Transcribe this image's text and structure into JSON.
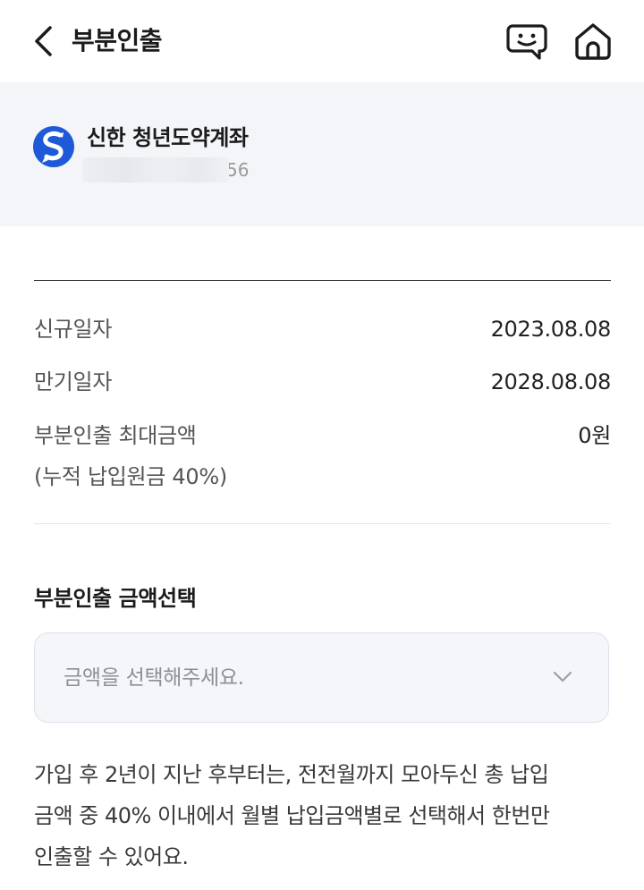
{
  "header": {
    "title": "부분인출",
    "back_icon": "chevron-left-icon",
    "chat_icon": "chat-bubble-icon",
    "home_icon": "home-icon"
  },
  "account": {
    "name": "신한 청년도약계좌",
    "number_visible_suffix": "56",
    "logo_icon": "shinhan-logo-icon",
    "logo_color": "#1e5ad8"
  },
  "info": {
    "rows": [
      {
        "label": "신규일자",
        "value": "2023.08.08"
      },
      {
        "label": "만기일자",
        "value": "2028.08.08"
      },
      {
        "label": "부분인출 최대금액",
        "sublabel": "(누적 납입원금 40%)",
        "value": "0원"
      }
    ]
  },
  "amount_select": {
    "title": "부분인출 금액선택",
    "placeholder": "금액을 선택해주세요.",
    "chevron_icon": "chevron-down-icon"
  },
  "notice": {
    "line1": "가입 후 2년이 지난 후부터는, 전전월까지 모아두신 총 납입",
    "line2": "금액 중 40% 이내에서 월별 납입금액별로 선택해서 한번만",
    "line3": "인출할 수 있어요."
  }
}
